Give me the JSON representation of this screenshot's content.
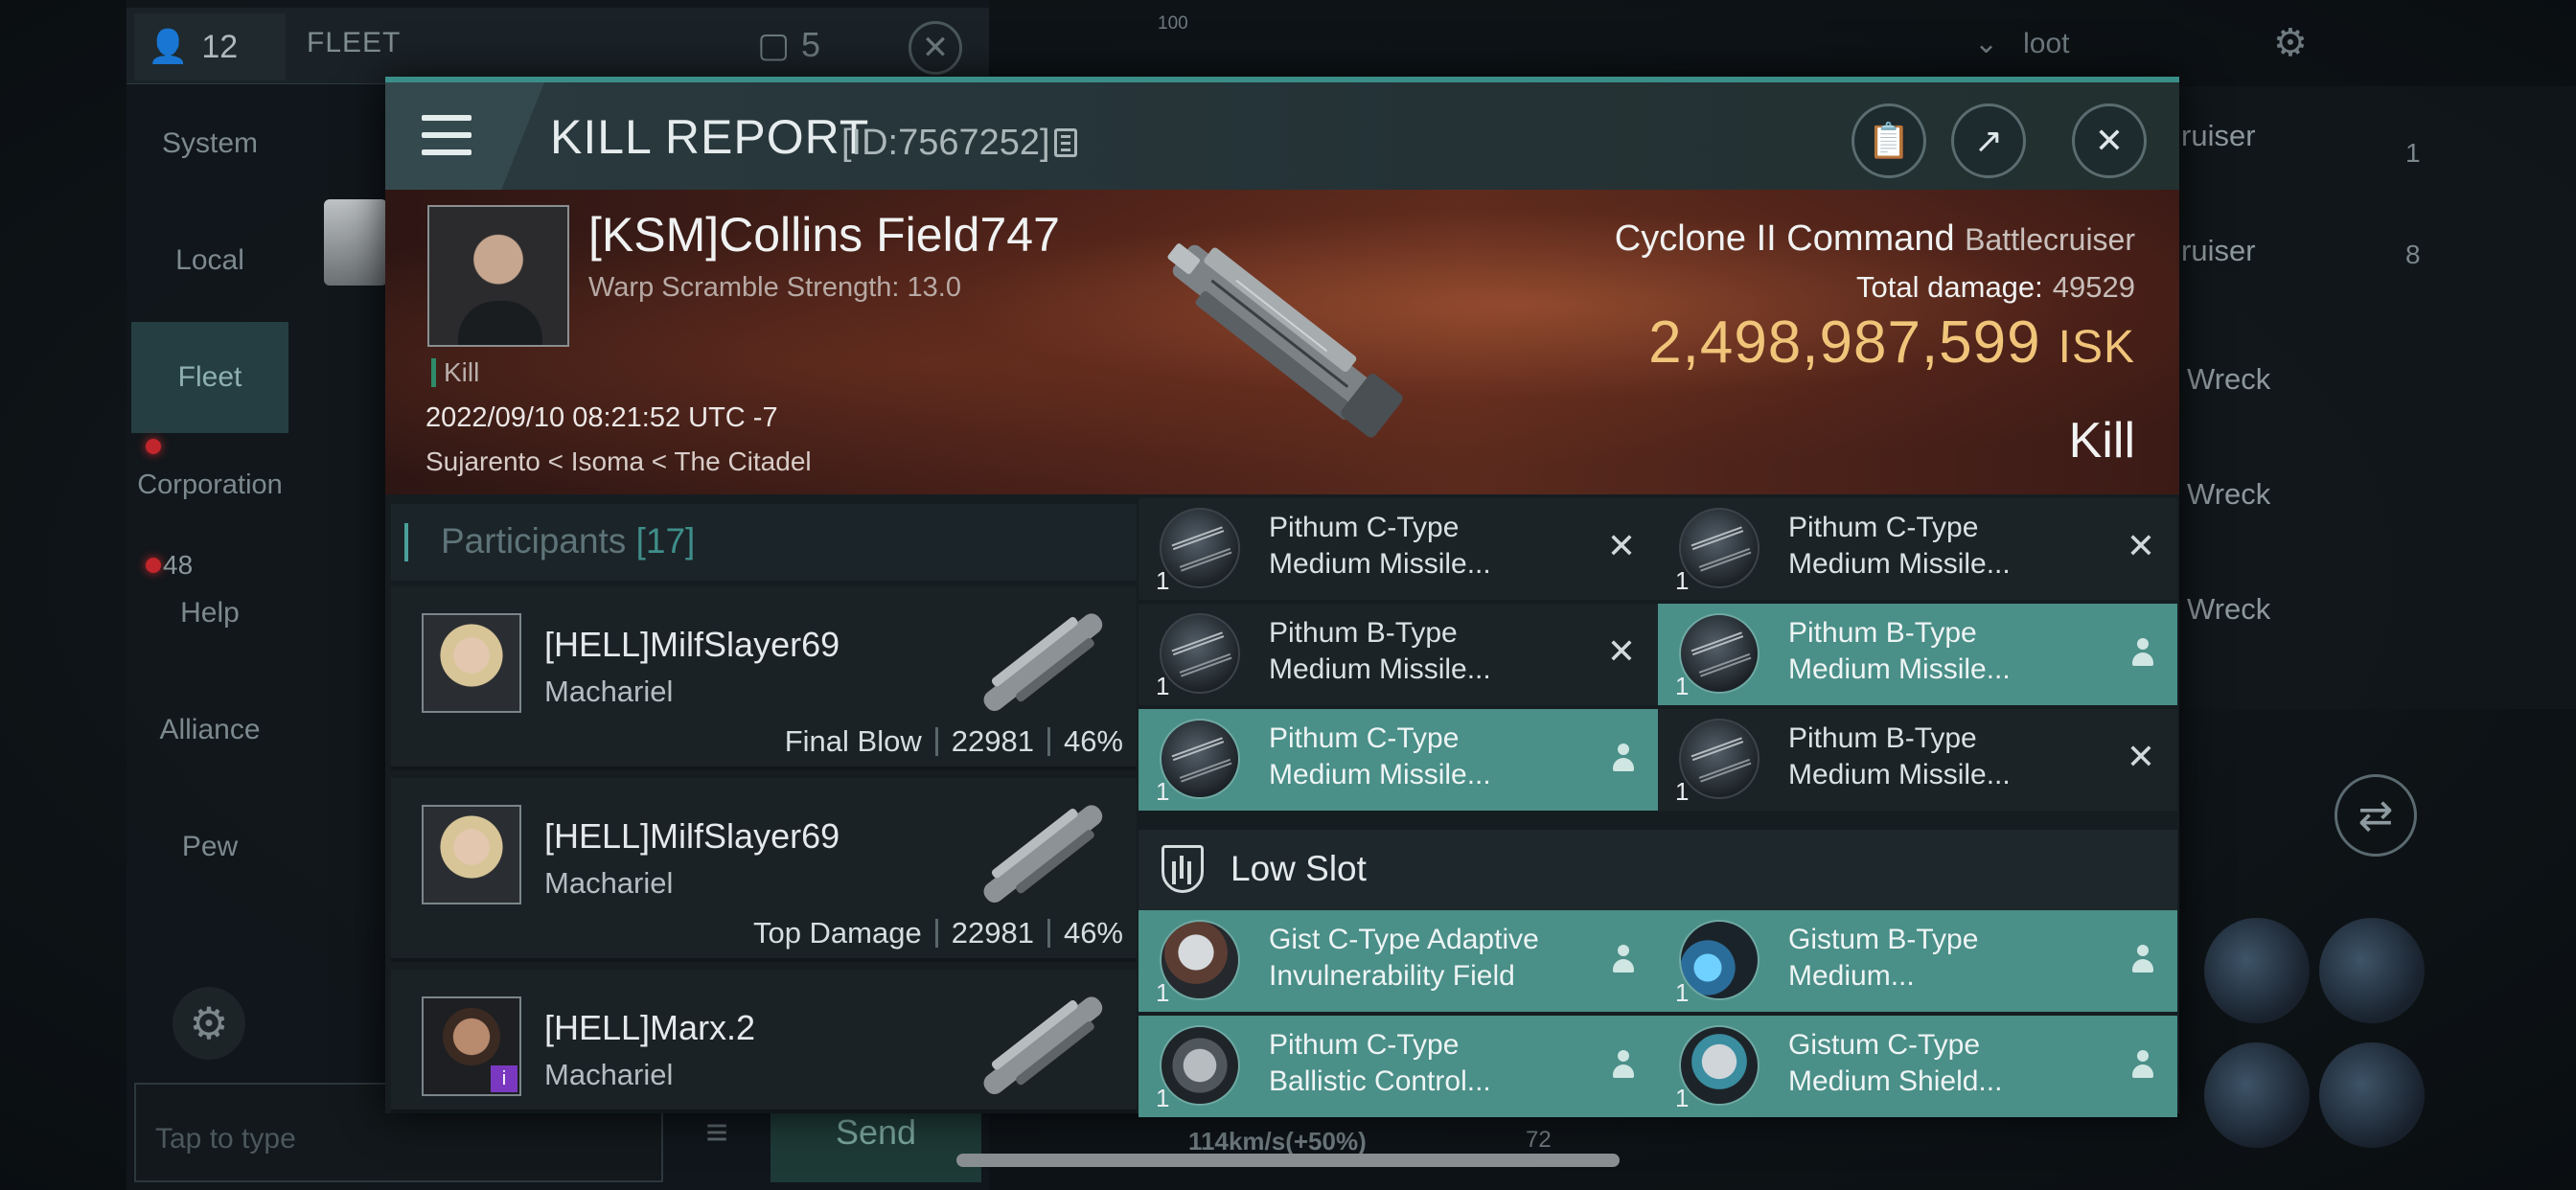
{
  "background": {
    "member_count": "12",
    "chat_channel_title": "FLEET",
    "count_badge": "5",
    "nav_items": [
      "System",
      "Local",
      "Fleet",
      "Corporation",
      "Help",
      "Alliance",
      "Pew"
    ],
    "unread_count": "48",
    "chat_placeholder": "Tap to type",
    "send_label": "Send",
    "filter_label": "loot",
    "overview_rows": [
      "ruiser",
      "ruiser",
      "Wreck",
      "Wreck",
      "Wreck"
    ],
    "overview_counts": [
      "1",
      "8"
    ],
    "map_scale": "100",
    "speed": "114km/s(+50%)",
    "speed_extra": "72"
  },
  "report": {
    "title": "KILL REPORT",
    "id_text": "[ID:7567252]",
    "victim": {
      "name": "[KSM]Collins Field747",
      "warp_scramble": "Warp Scramble Strength: 13.0",
      "tag": "Kill",
      "datetime": "2022/09/10 08:21:52 UTC -7",
      "location": "Sujarento < Isoma < The Citadel"
    },
    "ship": {
      "name": "Cyclone II Command",
      "class": "Battlecruiser",
      "total_damage_label": "Total damage:",
      "total_damage": "49529",
      "isk_value": "2,498,987,599",
      "isk_unit": "ISK",
      "result": "Kill"
    },
    "participants_label": "Participants",
    "participants_count": "[17]",
    "participants": [
      {
        "name": "[HELL]MilfSlayer69",
        "ship": "Machariel",
        "role": "Final Blow",
        "damage": "22981",
        "percent": "46%"
      },
      {
        "name": "[HELL]MilfSlayer69",
        "ship": "Machariel",
        "role": "Top Damage",
        "damage": "22981",
        "percent": "46%"
      },
      {
        "name": "[HELL]Marx.2",
        "ship": "Machariel",
        "role": "",
        "damage": "",
        "percent": ""
      }
    ],
    "modules": [
      {
        "line1": "Pithum C-Type",
        "line2": "Medium Missile...",
        "qty": "1",
        "state": "destroyed"
      },
      {
        "line1": "Pithum C-Type",
        "line2": "Medium Missile...",
        "qty": "1",
        "state": "destroyed"
      },
      {
        "line1": "Pithum B-Type",
        "line2": "Medium Missile...",
        "qty": "1",
        "state": "destroyed"
      },
      {
        "line1": "Pithum B-Type",
        "line2": "Medium Missile...",
        "qty": "1",
        "state": "dropped"
      },
      {
        "line1": "Pithum C-Type",
        "line2": "Medium Missile...",
        "qty": "1",
        "state": "dropped"
      },
      {
        "line1": "Pithum B-Type",
        "line2": "Medium Missile...",
        "qty": "1",
        "state": "destroyed"
      }
    ],
    "low_slot_label": "Low Slot",
    "low_modules": [
      {
        "line1": "Gist C-Type Adaptive",
        "line2": "Invulnerability Field",
        "qty": "1",
        "state": "dropped"
      },
      {
        "line1": "Gistum B-Type",
        "line2": "Medium...",
        "qty": "1",
        "state": "dropped"
      },
      {
        "line1": "Pithum C-Type",
        "line2": "Ballistic Control...",
        "qty": "1",
        "state": "dropped"
      },
      {
        "line1": "Gistum C-Type",
        "line2": "Medium Shield...",
        "qty": "1",
        "state": "dropped"
      }
    ],
    "colors": {
      "accent": "#3a8e88",
      "isk": "#f0c57a",
      "dropped_bg": "#4a8f88"
    }
  }
}
